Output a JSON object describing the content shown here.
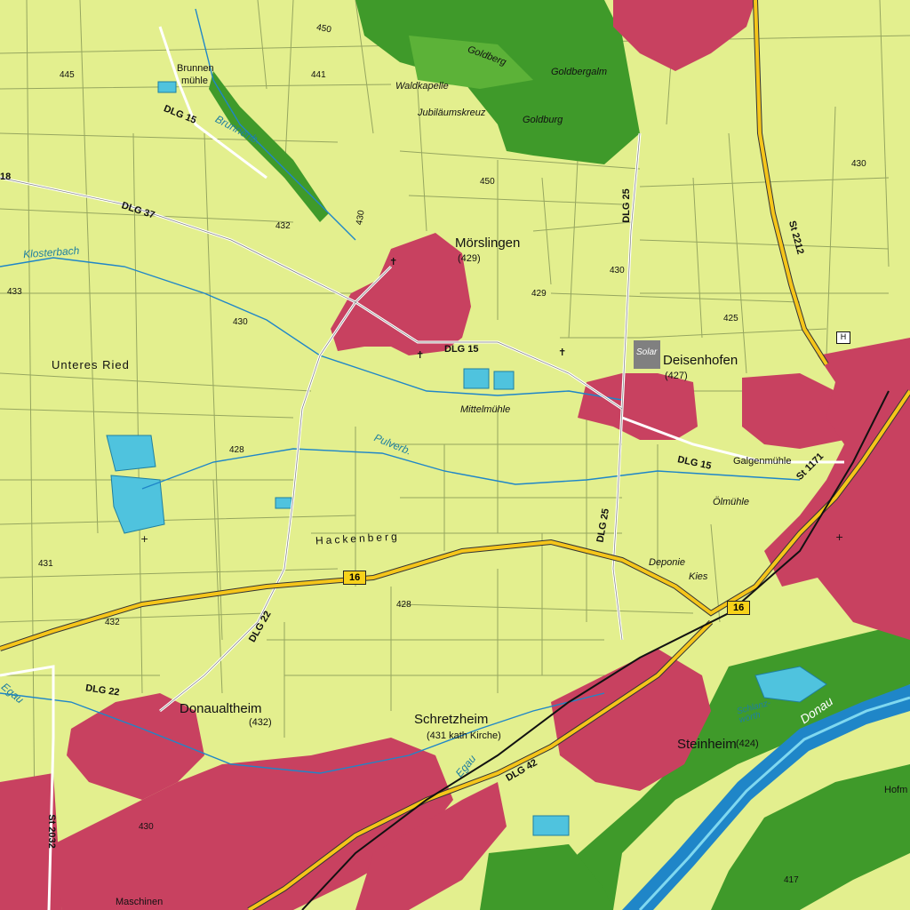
{
  "map": {
    "colors": {
      "field": "#e3ef8e",
      "forest": "#3f9a2a",
      "town": "#c84160",
      "water": "#4fc3de",
      "river": "#1f86c8",
      "main_road": "#f5c51a",
      "railway": "#111111",
      "field_lines": "#586b3a"
    },
    "places": {
      "moerslingen": "Mörslingen",
      "moerslingen_elev": "(429)",
      "deisenhofen": "Deisenhofen",
      "deisenhofen_elev": "(427)",
      "donaualtheim": "Donaualtheim",
      "donaualtheim_elev": "(432)",
      "schretzheim": "Schretzheim",
      "schretzheim_elev": "(431 kath Kirche)",
      "steinheim": "Steinheim",
      "steinheim_elev": "(424)"
    },
    "localities": {
      "brunnenmuehle_1": "Brunnen",
      "brunnenmuehle_2": "mühle",
      "waldkapelle": "Waldkapelle",
      "jubilaeumskreuz": "Jubiläumskreuz",
      "goldberg": "Goldberg",
      "goldbergalm": "Goldbergalm",
      "goldburg": "Goldburg",
      "unteres_ried": "Unteres Ried",
      "mittelmuehle": "Mittelmühle",
      "galgenmuehle": "Galgenmühle",
      "olmuehle": "Ölmühle",
      "hackenberg": "Hackenberg",
      "deponie": "Deponie",
      "kies": "Kies",
      "solar": "Solar",
      "schlanzwoerth": "Schlanz-wörth",
      "hofm": "Hofm",
      "maschinen": "Maschinen"
    },
    "waters": {
      "klosterbach": "Klosterbach",
      "brunnenbach": "Brunnenb.",
      "pulverbach": "Pulverb.",
      "egau_left": "Egau",
      "egau": "Egau",
      "donau": "Donau"
    },
    "roads": {
      "dlg15_nw": "DLG 15",
      "dlg37": "DLG 37",
      "dlg15_center": "DLG 15",
      "dlg15_east": "DLG 15",
      "dlg25_north": "DLG 25",
      "dlg25_south": "DLG 25",
      "dlg22_center": "DLG 22",
      "dlg22_west": "DLG 22",
      "dlg42": "DLG 42",
      "st2212": "St 2212",
      "st2032": "St 2032",
      "st1171": "St 1171",
      "b16_west": "16",
      "b16_east": "16",
      "edge_18": "18"
    },
    "elevations": [
      "445",
      "450",
      "441",
      "450",
      "432",
      "433",
      "430",
      "429",
      "430",
      "425",
      "430",
      "428",
      "431",
      "432",
      "428",
      "430",
      "430",
      "417"
    ],
    "symbols": {
      "heliport": "H"
    }
  }
}
